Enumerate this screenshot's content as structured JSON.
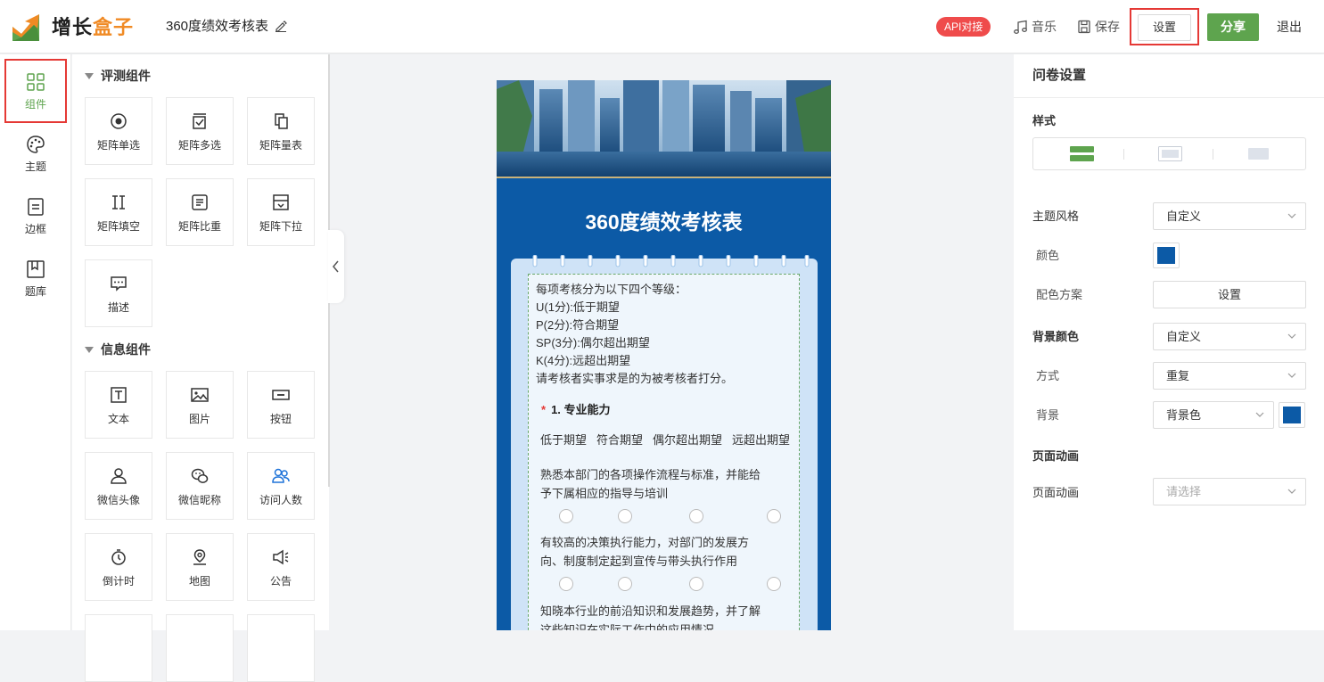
{
  "header": {
    "brand_part1": "增长",
    "brand_part2": "盒子",
    "doc_title": "360度绩效考核表",
    "api_badge": "API对接",
    "music_label": "音乐",
    "save_label": "保存",
    "settings_label": "设置",
    "share_label": "分享",
    "exit_label": "退出"
  },
  "rail": {
    "items": [
      {
        "label": "组件",
        "icon": "grid-icon"
      },
      {
        "label": "主题",
        "icon": "palette-icon"
      },
      {
        "label": "边框",
        "icon": "border-icon"
      },
      {
        "label": "题库",
        "icon": "bookmark-icon"
      }
    ]
  },
  "widgets": {
    "section1_title": "评测组件",
    "section1": [
      {
        "label": "矩阵单选",
        "icon": "radio-icon"
      },
      {
        "label": "矩阵多选",
        "icon": "checkbox-icon"
      },
      {
        "label": "矩阵量表",
        "icon": "copy-icon"
      },
      {
        "label": "矩阵填空",
        "icon": "text-cursor-icon"
      },
      {
        "label": "矩阵比重",
        "icon": "weight-icon"
      },
      {
        "label": "矩阵下拉",
        "icon": "dropdown-icon"
      },
      {
        "label": "描述",
        "icon": "comment-icon"
      }
    ],
    "section2_title": "信息组件",
    "section2": [
      {
        "label": "文本",
        "icon": "text-icon"
      },
      {
        "label": "图片",
        "icon": "image-icon"
      },
      {
        "label": "按钮",
        "icon": "button-icon"
      },
      {
        "label": "微信头像",
        "icon": "user-icon"
      },
      {
        "label": "微信昵称",
        "icon": "wechat-icon"
      },
      {
        "label": "访问人数",
        "icon": "users-icon"
      },
      {
        "label": "倒计时",
        "icon": "timer-icon"
      },
      {
        "label": "地图",
        "icon": "map-pin-icon"
      },
      {
        "label": "公告",
        "icon": "megaphone-icon"
      }
    ]
  },
  "survey": {
    "title": "360度绩效考核表",
    "intro": [
      "每项考核分为以下四个等级：",
      "U(1分):低于期望",
      "P(2分):符合期望",
      "SP(3分):偶尔超出期望",
      "K(4分):远超出期望",
      "请考核者实事求是的为被考核者打分。"
    ],
    "question_star": "*",
    "question_title": "1. 专业能力",
    "options": [
      "低于期望",
      "符合期望",
      "偶尔超出期望",
      "远超出期望"
    ],
    "rows": [
      [
        "熟悉本部门的各项操作流程与标准，并能给",
        "予下属相应的指导与培训"
      ],
      [
        "有较高的决策执行能力，对部门的发展方",
        "向、制度制定起到宣传与带头执行作用"
      ],
      [
        "知晓本行业的前沿知识和发展趋势，并了解",
        "这些知识在实际工作中的应用情况"
      ]
    ]
  },
  "settings": {
    "title": "问卷设置",
    "style_label": "样式",
    "theme_style_label": "主题风格",
    "theme_style_value": "自定义",
    "color_label": "颜色",
    "theme_color": "#0c5aa6",
    "scheme_label": "配色方案",
    "scheme_button": "设置",
    "bg_color_label": "背景颜色",
    "bg_color_value": "自定义",
    "mode_label": "方式",
    "mode_value": "重复",
    "bg_label": "背景",
    "bg_value": "背景色",
    "bg_swatch": "#0c5aa6",
    "anim_section": "页面动画",
    "anim_label": "页面动画",
    "anim_placeholder": "请选择"
  }
}
